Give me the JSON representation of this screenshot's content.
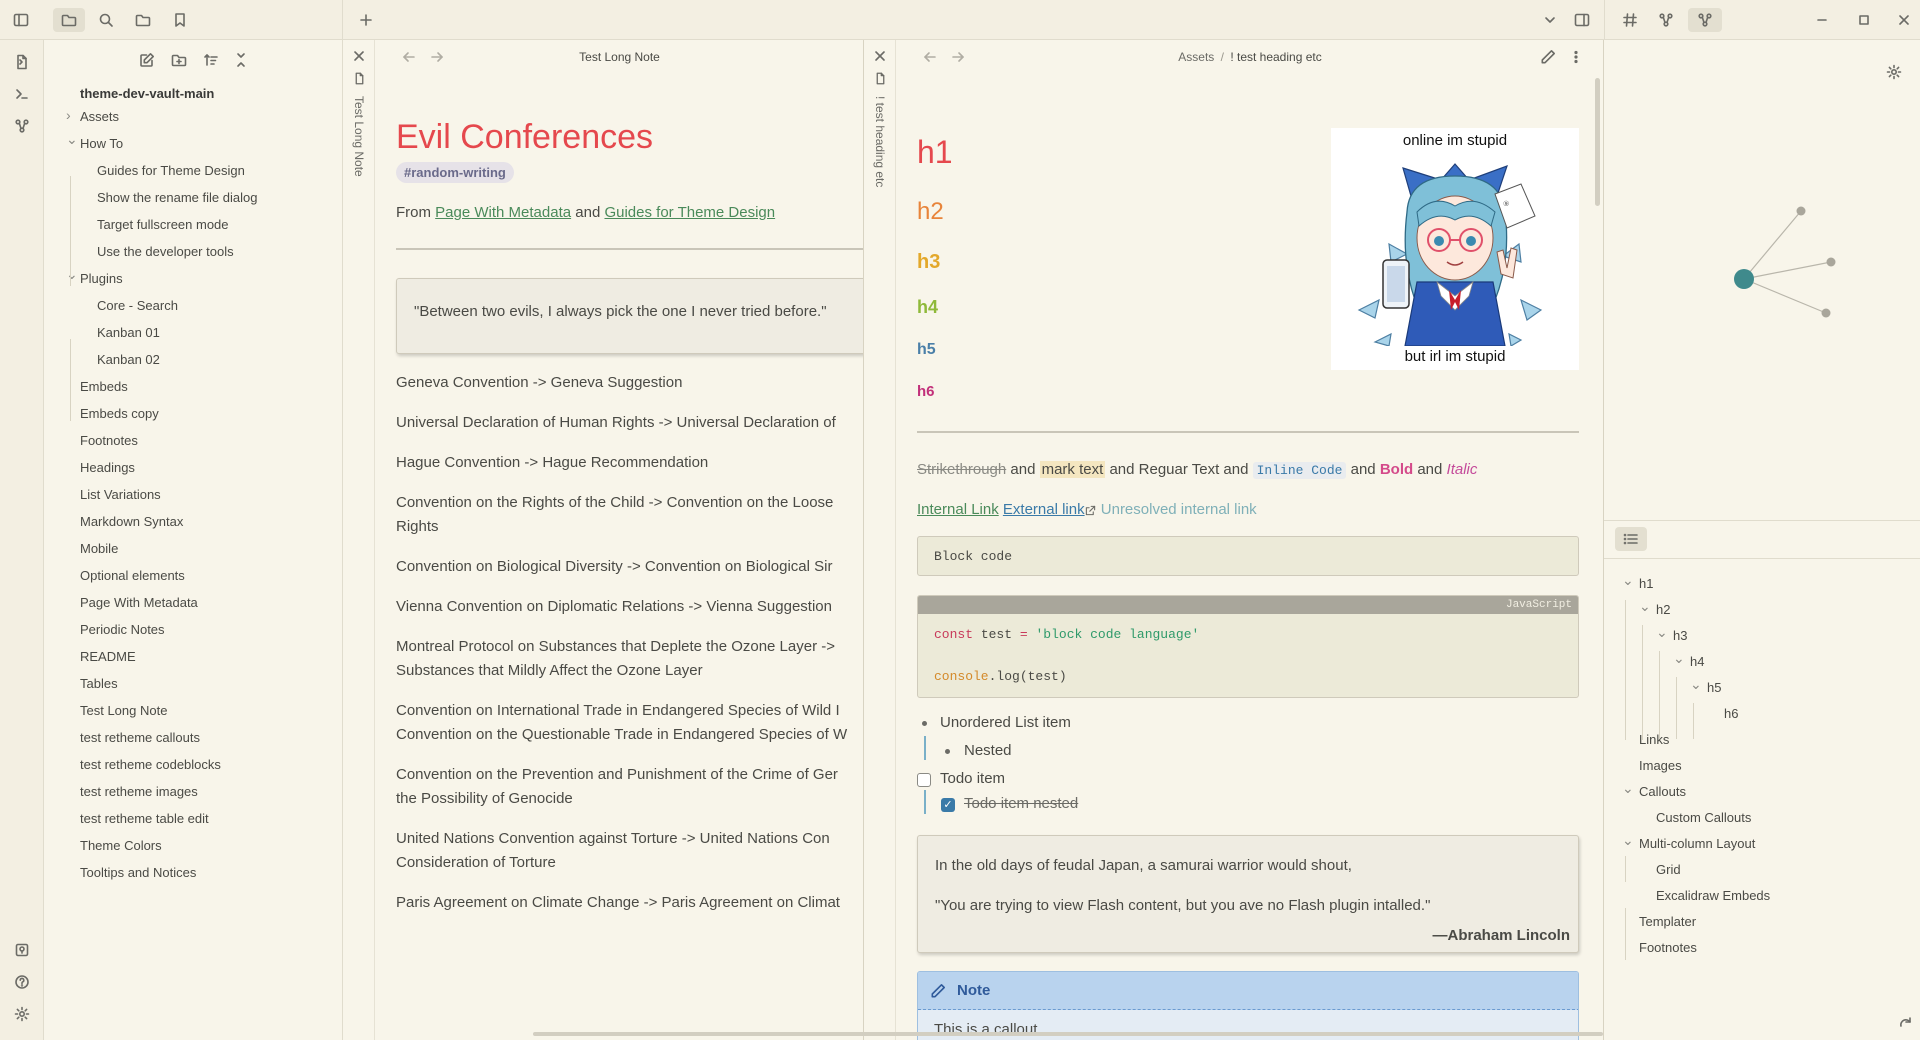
{
  "explorer": {
    "vault_name": "theme-dev-vault-main",
    "items": [
      {
        "label": "Assets",
        "indent": 0,
        "chev": "right"
      },
      {
        "label": "How To",
        "indent": 0,
        "chev": "down"
      },
      {
        "label": "Guides for Theme Design",
        "indent": 1
      },
      {
        "label": "Show the rename file dialog",
        "indent": 1
      },
      {
        "label": "Target fullscreen mode",
        "indent": 1
      },
      {
        "label": "Use the developer tools",
        "indent": 1
      },
      {
        "label": "Plugins",
        "indent": 0,
        "chev": "down"
      },
      {
        "label": "Core - Search",
        "indent": 1
      },
      {
        "label": "Kanban 01",
        "indent": 1
      },
      {
        "label": "Kanban 02",
        "indent": 1
      },
      {
        "label": "Embeds",
        "indent": 0
      },
      {
        "label": "Embeds copy",
        "indent": 0
      },
      {
        "label": "Footnotes",
        "indent": 0
      },
      {
        "label": "Headings",
        "indent": 0
      },
      {
        "label": "List Variations",
        "indent": 0
      },
      {
        "label": "Markdown Syntax",
        "indent": 0
      },
      {
        "label": "Mobile",
        "indent": 0
      },
      {
        "label": "Optional elements",
        "indent": 0
      },
      {
        "label": "Page With Metadata",
        "indent": 0
      },
      {
        "label": "Periodic Notes",
        "indent": 0
      },
      {
        "label": "README",
        "indent": 0
      },
      {
        "label": "Tables",
        "indent": 0
      },
      {
        "label": "Test Long Note",
        "indent": 0
      },
      {
        "label": "test retheme callouts",
        "indent": 0
      },
      {
        "label": "test retheme codeblocks",
        "indent": 0
      },
      {
        "label": "test retheme images",
        "indent": 0
      },
      {
        "label": "test retheme table edit",
        "indent": 0
      },
      {
        "label": "Theme Colors",
        "indent": 0
      },
      {
        "label": "Tooltips and Notices",
        "indent": 0
      }
    ]
  },
  "pane1": {
    "tab_title": "Test Long Note",
    "vertical_label": "Test Long Note",
    "heading": "Evil Conferences",
    "tag": "#random-writing",
    "from_prefix": "From",
    "link1": "Page With Metadata",
    "and_word": "and",
    "link2": "Guides for Theme Design",
    "quote": "\"Between two evils, I always pick the one I never tried before.\"",
    "lines": [
      [
        "Geneva Convention -> Geneva Suggestion"
      ],
      [
        "Universal Declaration of Human Rights -> Universal Declaration of"
      ],
      [
        "Hague Convention -> Hague Recommendation"
      ],
      [
        "Convention on the Rights of the Child -> Convention on the Loose",
        "Rights"
      ],
      [
        "Convention on Biological Diversity -> Convention on Biological Sir"
      ],
      [
        "Vienna Convention on Diplomatic Relations -> Vienna Suggestion"
      ],
      [
        "Montreal Protocol on Substances that Deplete the Ozone Layer ->",
        "Substances that Mildly Affect the Ozone Layer"
      ],
      [
        "Convention on International Trade in Endangered Species of Wild I",
        "Convention on the Questionable Trade in Endangered Species of W"
      ],
      [
        "Convention on the Prevention and Punishment of the Crime of Ger",
        "the Possibility of Genocide"
      ],
      [
        "United Nations Convention against Torture -> United Nations Con",
        "Consideration of Torture"
      ],
      [
        "Paris Agreement on Climate Change -> Paris Agreement on Climat"
      ]
    ]
  },
  "pane2": {
    "breadcrumb_folder": "Assets",
    "breadcrumb_sep": "/",
    "breadcrumb_note": "! test heading etc",
    "vertical_label": "! test heading etc",
    "headings": [
      "h1",
      "h2",
      "h3",
      "h4",
      "h5",
      "h6"
    ],
    "heading_colors": [
      "#e5484d",
      "#e8843a",
      "#e3a82b",
      "#8fb93a",
      "#4a7fa8",
      "#c2307a"
    ],
    "image_caption_top": "online im stupid",
    "image_caption_bottom": "but irl im stupid",
    "inline": {
      "strike": "Strikethrough",
      "and1": "and",
      "mark": "mark text",
      "and2": "and Reguar Text and",
      "code": "Inline Code",
      "and3": "and",
      "bold": "Bold",
      "and4": "and",
      "italic": "Italic"
    },
    "links": {
      "internal": "Internal Link",
      "external": "External link",
      "unresolved": "Unresolved internal link"
    },
    "block_code": "Block code",
    "code_lang": "JavaScript",
    "code_line1_kw": "const",
    "code_line1_var": "test",
    "code_line1_eq": "=",
    "code_line1_str": "'block code language'",
    "code_line2_obj": "console",
    "code_line2_fn": ".log",
    "code_line2_arg": "(test)",
    "list": {
      "ul1": "Unordered List item",
      "ul2": "Nested",
      "todo1": "Todo item",
      "todo2": "Todo item nested"
    },
    "blockquote": {
      "line1": "In the old days of feudal Japan, a samurai warrior would shout,",
      "line2": "\"You are trying to view Flash content, but you ave no Flash plugin intalled.\"",
      "attribution": "—Abraham Lincoln"
    },
    "callout_title": "Note",
    "callout_body": "This is a callout"
  },
  "outline": {
    "items": [
      {
        "label": "h1",
        "level": 0,
        "chev": true
      },
      {
        "label": "h2",
        "level": 1,
        "chev": true
      },
      {
        "label": "h3",
        "level": 2,
        "chev": true
      },
      {
        "label": "h4",
        "level": 3,
        "chev": true
      },
      {
        "label": "h5",
        "level": 4,
        "chev": true
      },
      {
        "label": "h6",
        "level": 5,
        "chev": false
      },
      {
        "label": "Links",
        "level": 0,
        "chev": false
      },
      {
        "label": "Images",
        "level": 0,
        "chev": false
      },
      {
        "label": "Callouts",
        "level": 0,
        "chev": true
      },
      {
        "label": "Custom Callouts",
        "level": 1,
        "chev": false
      },
      {
        "label": "Multi-column Layout",
        "level": 0,
        "chev": true
      },
      {
        "label": "Grid",
        "level": 1,
        "chev": false
      },
      {
        "label": "Excalidraw Embeds",
        "level": 1,
        "chev": false
      },
      {
        "label": "Templater",
        "level": 0,
        "chev": false
      },
      {
        "label": "Footnotes",
        "level": 0,
        "chev": false
      }
    ]
  },
  "colors": {
    "accent_teal": "#3f8a8c",
    "link_green": "#4a8a5a",
    "heading_red": "#e5484d",
    "bg": "#f8f5ea"
  }
}
